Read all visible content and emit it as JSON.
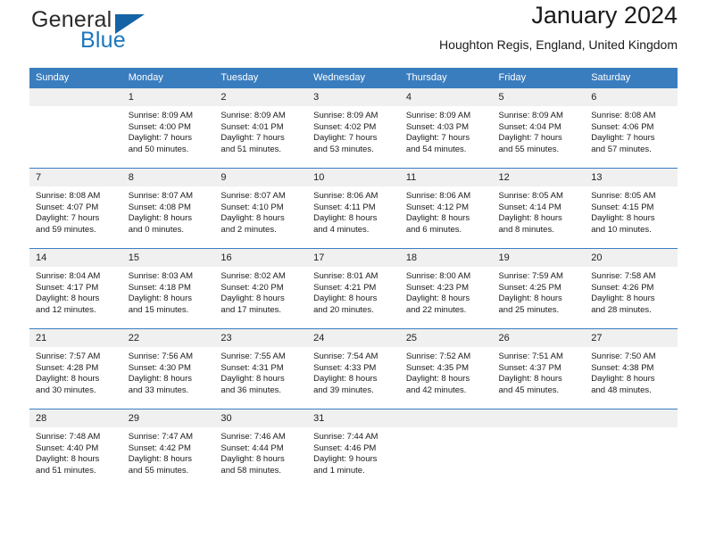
{
  "logo": {
    "word_one": "General",
    "word_two": "Blue",
    "triangle_icon": "blue-triangle-icon"
  },
  "header": {
    "title": "January 2024",
    "location": "Houghton Regis, England, United Kingdom"
  },
  "colors": {
    "header_blue": "#3a7dbf",
    "logo_blue": "#1b76bc",
    "day_band": "#f0f0f0"
  },
  "weekdays": [
    "Sunday",
    "Monday",
    "Tuesday",
    "Wednesday",
    "Thursday",
    "Friday",
    "Saturday"
  ],
  "weeks": [
    [
      {
        "day": "",
        "sunrise": "",
        "sunset": "",
        "daylight_line1": "",
        "daylight_line2": ""
      },
      {
        "day": "1",
        "sunrise": "Sunrise: 8:09 AM",
        "sunset": "Sunset: 4:00 PM",
        "daylight_line1": "Daylight: 7 hours",
        "daylight_line2": "and 50 minutes."
      },
      {
        "day": "2",
        "sunrise": "Sunrise: 8:09 AM",
        "sunset": "Sunset: 4:01 PM",
        "daylight_line1": "Daylight: 7 hours",
        "daylight_line2": "and 51 minutes."
      },
      {
        "day": "3",
        "sunrise": "Sunrise: 8:09 AM",
        "sunset": "Sunset: 4:02 PM",
        "daylight_line1": "Daylight: 7 hours",
        "daylight_line2": "and 53 minutes."
      },
      {
        "day": "4",
        "sunrise": "Sunrise: 8:09 AM",
        "sunset": "Sunset: 4:03 PM",
        "daylight_line1": "Daylight: 7 hours",
        "daylight_line2": "and 54 minutes."
      },
      {
        "day": "5",
        "sunrise": "Sunrise: 8:09 AM",
        "sunset": "Sunset: 4:04 PM",
        "daylight_line1": "Daylight: 7 hours",
        "daylight_line2": "and 55 minutes."
      },
      {
        "day": "6",
        "sunrise": "Sunrise: 8:08 AM",
        "sunset": "Sunset: 4:06 PM",
        "daylight_line1": "Daylight: 7 hours",
        "daylight_line2": "and 57 minutes."
      }
    ],
    [
      {
        "day": "7",
        "sunrise": "Sunrise: 8:08 AM",
        "sunset": "Sunset: 4:07 PM",
        "daylight_line1": "Daylight: 7 hours",
        "daylight_line2": "and 59 minutes."
      },
      {
        "day": "8",
        "sunrise": "Sunrise: 8:07 AM",
        "sunset": "Sunset: 4:08 PM",
        "daylight_line1": "Daylight: 8 hours",
        "daylight_line2": "and 0 minutes."
      },
      {
        "day": "9",
        "sunrise": "Sunrise: 8:07 AM",
        "sunset": "Sunset: 4:10 PM",
        "daylight_line1": "Daylight: 8 hours",
        "daylight_line2": "and 2 minutes."
      },
      {
        "day": "10",
        "sunrise": "Sunrise: 8:06 AM",
        "sunset": "Sunset: 4:11 PM",
        "daylight_line1": "Daylight: 8 hours",
        "daylight_line2": "and 4 minutes."
      },
      {
        "day": "11",
        "sunrise": "Sunrise: 8:06 AM",
        "sunset": "Sunset: 4:12 PM",
        "daylight_line1": "Daylight: 8 hours",
        "daylight_line2": "and 6 minutes."
      },
      {
        "day": "12",
        "sunrise": "Sunrise: 8:05 AM",
        "sunset": "Sunset: 4:14 PM",
        "daylight_line1": "Daylight: 8 hours",
        "daylight_line2": "and 8 minutes."
      },
      {
        "day": "13",
        "sunrise": "Sunrise: 8:05 AM",
        "sunset": "Sunset: 4:15 PM",
        "daylight_line1": "Daylight: 8 hours",
        "daylight_line2": "and 10 minutes."
      }
    ],
    [
      {
        "day": "14",
        "sunrise": "Sunrise: 8:04 AM",
        "sunset": "Sunset: 4:17 PM",
        "daylight_line1": "Daylight: 8 hours",
        "daylight_line2": "and 12 minutes."
      },
      {
        "day": "15",
        "sunrise": "Sunrise: 8:03 AM",
        "sunset": "Sunset: 4:18 PM",
        "daylight_line1": "Daylight: 8 hours",
        "daylight_line2": "and 15 minutes."
      },
      {
        "day": "16",
        "sunrise": "Sunrise: 8:02 AM",
        "sunset": "Sunset: 4:20 PM",
        "daylight_line1": "Daylight: 8 hours",
        "daylight_line2": "and 17 minutes."
      },
      {
        "day": "17",
        "sunrise": "Sunrise: 8:01 AM",
        "sunset": "Sunset: 4:21 PM",
        "daylight_line1": "Daylight: 8 hours",
        "daylight_line2": "and 20 minutes."
      },
      {
        "day": "18",
        "sunrise": "Sunrise: 8:00 AM",
        "sunset": "Sunset: 4:23 PM",
        "daylight_line1": "Daylight: 8 hours",
        "daylight_line2": "and 22 minutes."
      },
      {
        "day": "19",
        "sunrise": "Sunrise: 7:59 AM",
        "sunset": "Sunset: 4:25 PM",
        "daylight_line1": "Daylight: 8 hours",
        "daylight_line2": "and 25 minutes."
      },
      {
        "day": "20",
        "sunrise": "Sunrise: 7:58 AM",
        "sunset": "Sunset: 4:26 PM",
        "daylight_line1": "Daylight: 8 hours",
        "daylight_line2": "and 28 minutes."
      }
    ],
    [
      {
        "day": "21",
        "sunrise": "Sunrise: 7:57 AM",
        "sunset": "Sunset: 4:28 PM",
        "daylight_line1": "Daylight: 8 hours",
        "daylight_line2": "and 30 minutes."
      },
      {
        "day": "22",
        "sunrise": "Sunrise: 7:56 AM",
        "sunset": "Sunset: 4:30 PM",
        "daylight_line1": "Daylight: 8 hours",
        "daylight_line2": "and 33 minutes."
      },
      {
        "day": "23",
        "sunrise": "Sunrise: 7:55 AM",
        "sunset": "Sunset: 4:31 PM",
        "daylight_line1": "Daylight: 8 hours",
        "daylight_line2": "and 36 minutes."
      },
      {
        "day": "24",
        "sunrise": "Sunrise: 7:54 AM",
        "sunset": "Sunset: 4:33 PM",
        "daylight_line1": "Daylight: 8 hours",
        "daylight_line2": "and 39 minutes."
      },
      {
        "day": "25",
        "sunrise": "Sunrise: 7:52 AM",
        "sunset": "Sunset: 4:35 PM",
        "daylight_line1": "Daylight: 8 hours",
        "daylight_line2": "and 42 minutes."
      },
      {
        "day": "26",
        "sunrise": "Sunrise: 7:51 AM",
        "sunset": "Sunset: 4:37 PM",
        "daylight_line1": "Daylight: 8 hours",
        "daylight_line2": "and 45 minutes."
      },
      {
        "day": "27",
        "sunrise": "Sunrise: 7:50 AM",
        "sunset": "Sunset: 4:38 PM",
        "daylight_line1": "Daylight: 8 hours",
        "daylight_line2": "and 48 minutes."
      }
    ],
    [
      {
        "day": "28",
        "sunrise": "Sunrise: 7:48 AM",
        "sunset": "Sunset: 4:40 PM",
        "daylight_line1": "Daylight: 8 hours",
        "daylight_line2": "and 51 minutes."
      },
      {
        "day": "29",
        "sunrise": "Sunrise: 7:47 AM",
        "sunset": "Sunset: 4:42 PM",
        "daylight_line1": "Daylight: 8 hours",
        "daylight_line2": "and 55 minutes."
      },
      {
        "day": "30",
        "sunrise": "Sunrise: 7:46 AM",
        "sunset": "Sunset: 4:44 PM",
        "daylight_line1": "Daylight: 8 hours",
        "daylight_line2": "and 58 minutes."
      },
      {
        "day": "31",
        "sunrise": "Sunrise: 7:44 AM",
        "sunset": "Sunset: 4:46 PM",
        "daylight_line1": "Daylight: 9 hours",
        "daylight_line2": "and 1 minute."
      },
      {
        "day": "",
        "sunrise": "",
        "sunset": "",
        "daylight_line1": "",
        "daylight_line2": ""
      },
      {
        "day": "",
        "sunrise": "",
        "sunset": "",
        "daylight_line1": "",
        "daylight_line2": ""
      },
      {
        "day": "",
        "sunrise": "",
        "sunset": "",
        "daylight_line1": "",
        "daylight_line2": ""
      }
    ]
  ]
}
